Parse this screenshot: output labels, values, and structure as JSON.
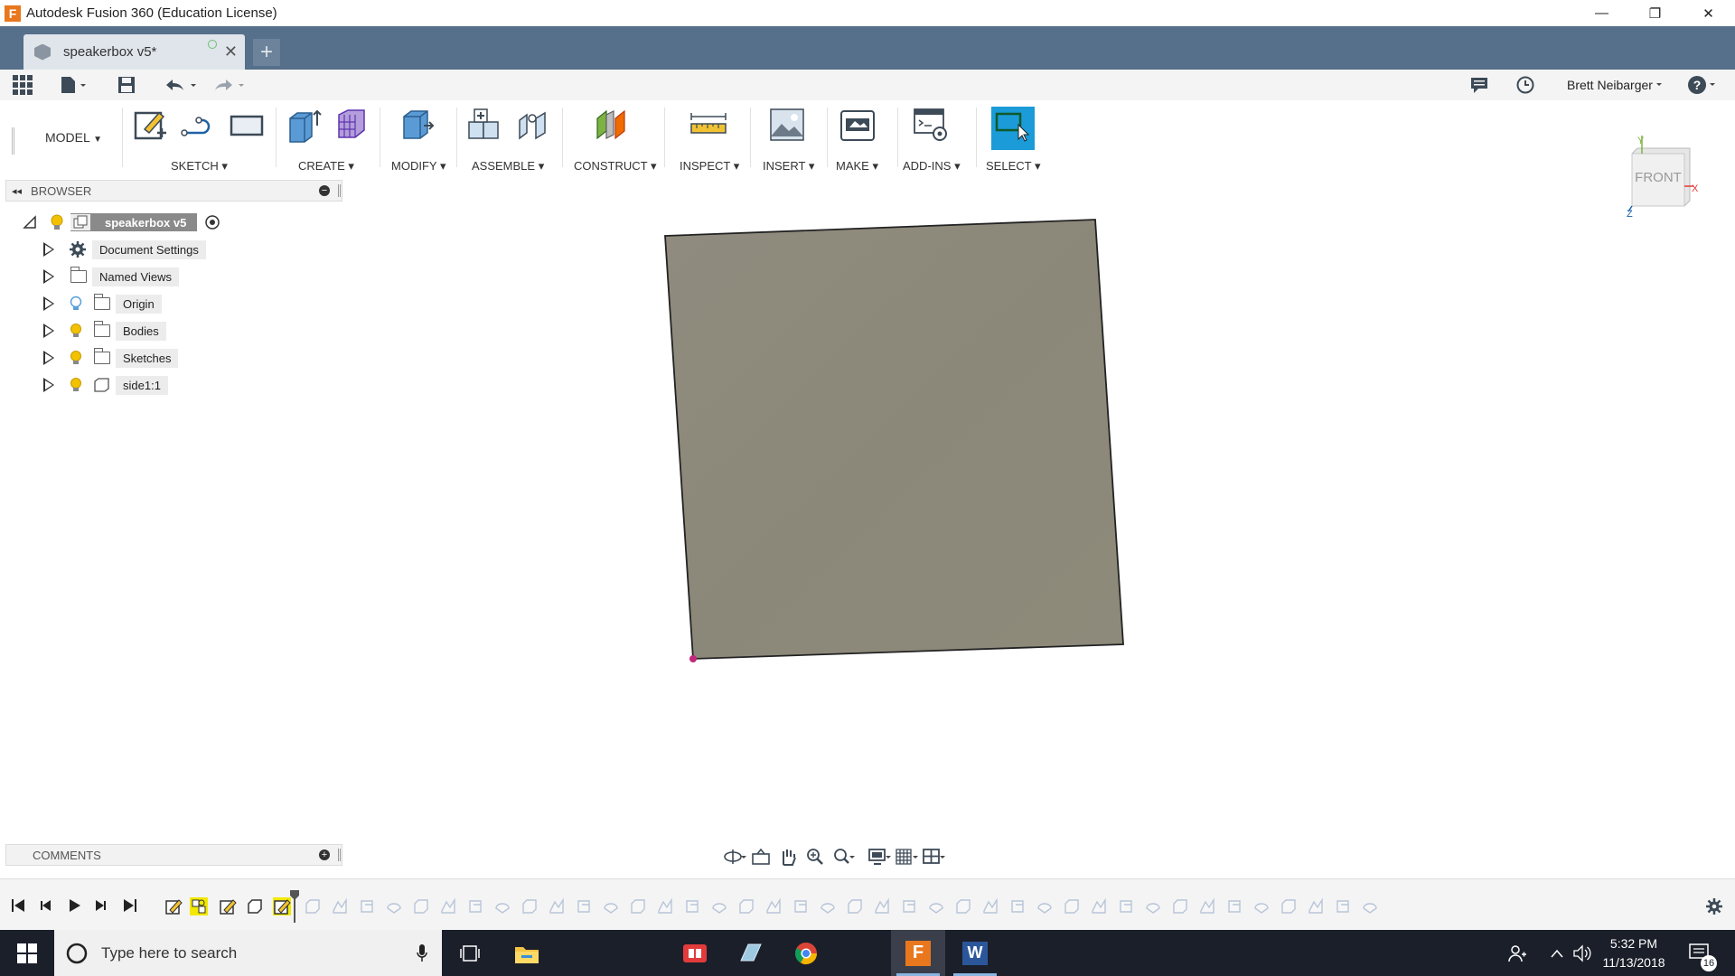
{
  "window": {
    "title": "Autodesk Fusion 360 (Education License)",
    "minimize": "—",
    "restore": "❐",
    "close": "✕"
  },
  "doc_tab": {
    "name": "speakerbox v5*",
    "close": "✕",
    "new_tab": "+"
  },
  "quick_access": {
    "user_name": "Brett Neibarger",
    "help": "?"
  },
  "ribbon": {
    "workspace": "MODEL",
    "groups": [
      "SKETCH",
      "CREATE",
      "MODIFY",
      "ASSEMBLE",
      "CONSTRUCT",
      "INSPECT",
      "INSERT",
      "MAKE",
      "ADD-INS",
      "SELECT"
    ],
    "select_color": "#1b9bd8"
  },
  "browser": {
    "title": "BROWSER",
    "root": "speakerbox v5",
    "items": [
      {
        "label": "Document Settings",
        "icon": "gear-icon"
      },
      {
        "label": "Named Views",
        "icon": "folder-icon"
      },
      {
        "label": "Origin",
        "icon": "folder-icon"
      },
      {
        "label": "Bodies",
        "icon": "folder-icon"
      },
      {
        "label": "Sketches",
        "icon": "folder-icon"
      },
      {
        "label": "side1:1",
        "icon": "component-icon"
      }
    ]
  },
  "viewcube": {
    "face": "FRONT",
    "axis_x": "X",
    "axis_y": "Y",
    "axis_z": "Z"
  },
  "comments": {
    "title": "COMMENTS"
  },
  "taskbar": {
    "search_placeholder": "Type here to search",
    "time": "5:32 PM",
    "date": "11/13/2018",
    "notifications": "16"
  },
  "colors": {
    "tab_bar": "#566f8a",
    "body_face": "#8c887a",
    "taskbar": "#1b1f2a"
  }
}
